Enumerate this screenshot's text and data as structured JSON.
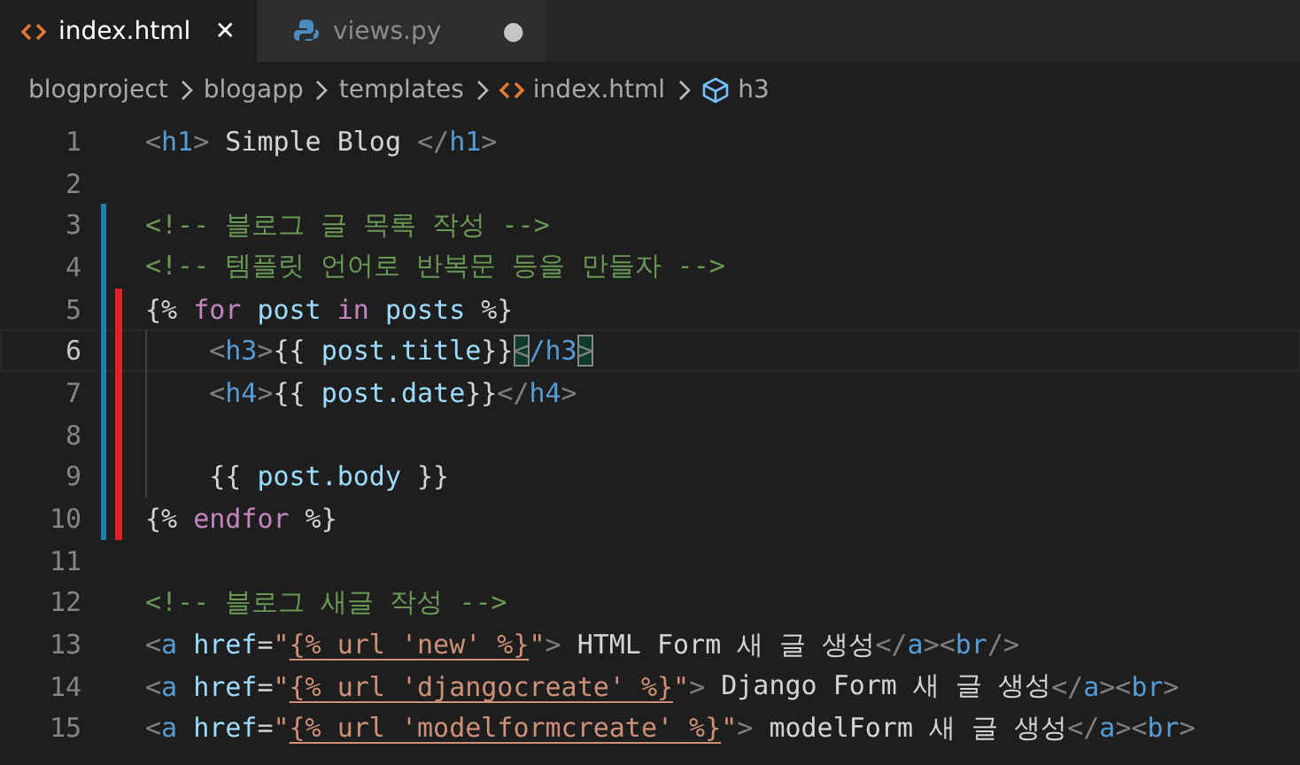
{
  "tabs": [
    {
      "label": "index.html",
      "kind": "html",
      "selected": true,
      "dirty": false,
      "close": "✕"
    },
    {
      "label": "views.py",
      "kind": "python",
      "selected": false,
      "dirty": true,
      "close": "●"
    }
  ],
  "breadcrumb": [
    {
      "label": "blogproject",
      "kind": "folder"
    },
    {
      "label": "blogapp",
      "kind": "folder"
    },
    {
      "label": "templates",
      "kind": "folder"
    },
    {
      "label": "index.html",
      "kind": "html"
    },
    {
      "label": "h3",
      "kind": "element"
    }
  ],
  "lines": [
    {
      "number": "1",
      "current": false,
      "modified": false,
      "annotated": false,
      "indented": false,
      "tokens": [
        {
          "kind": "punct",
          "text": "<"
        },
        {
          "kind": "tag",
          "text": "h1"
        },
        {
          "kind": "punct",
          "text": ">"
        },
        {
          "kind": "text",
          "text": " Simple Blog "
        },
        {
          "kind": "punct",
          "text": "</"
        },
        {
          "kind": "tag",
          "text": "h1"
        },
        {
          "kind": "punct",
          "text": ">"
        }
      ]
    },
    {
      "number": "2",
      "current": false,
      "modified": false,
      "annotated": false,
      "indented": false
    },
    {
      "number": "3",
      "current": false,
      "modified": true,
      "annotated": false,
      "indented": false,
      "tokens": [
        {
          "kind": "comment",
          "text": "<!-- 블로그 글 목록 작성 -->"
        }
      ]
    },
    {
      "number": "4",
      "current": false,
      "modified": true,
      "annotated": false,
      "indented": false,
      "tokens": [
        {
          "kind": "comment",
          "text": "<!-- 템플릿 언어로 반복문 등을 만들자 -->"
        }
      ]
    },
    {
      "number": "5",
      "current": false,
      "modified": true,
      "annotated": true,
      "indented": false,
      "tokens": [
        {
          "kind": "brace",
          "text": "{% "
        },
        {
          "kind": "keyword",
          "text": "for"
        },
        {
          "kind": "var",
          "text": " post "
        },
        {
          "kind": "keyword",
          "text": "in"
        },
        {
          "kind": "var",
          "text": " posts "
        },
        {
          "kind": "brace",
          "text": "%}"
        }
      ]
    },
    {
      "number": "6",
      "current": true,
      "modified": true,
      "annotated": true,
      "indented": true,
      "tokens": [
        {
          "kind": "punct",
          "text": "<"
        },
        {
          "kind": "tag",
          "text": "h3"
        },
        {
          "kind": "punct",
          "text": ">"
        },
        {
          "kind": "brace",
          "text": "{{ "
        },
        {
          "kind": "var",
          "text": "post.title"
        },
        {
          "kind": "brace",
          "text": "}}"
        },
        {
          "kind": "match",
          "text": "<"
        },
        {
          "kind": "tag",
          "text": "/h3"
        },
        {
          "kind": "match",
          "text": ">"
        }
      ]
    },
    {
      "number": "7",
      "current": false,
      "modified": true,
      "annotated": true,
      "indented": true,
      "tokens": [
        {
          "kind": "punct",
          "text": "<"
        },
        {
          "kind": "tag",
          "text": "h4"
        },
        {
          "kind": "punct",
          "text": ">"
        },
        {
          "kind": "brace",
          "text": "{{ "
        },
        {
          "kind": "var",
          "text": "post.date"
        },
        {
          "kind": "brace",
          "text": "}}"
        },
        {
          "kind": "punct",
          "text": "</"
        },
        {
          "kind": "tag",
          "text": "h4"
        },
        {
          "kind": "punct",
          "text": ">"
        }
      ]
    },
    {
      "number": "8",
      "current": false,
      "modified": true,
      "annotated": true,
      "indented": true
    },
    {
      "number": "9",
      "current": false,
      "modified": true,
      "annotated": true,
      "indented": true,
      "tokens": [
        {
          "kind": "brace",
          "text": "{{ "
        },
        {
          "kind": "var",
          "text": "post.body"
        },
        {
          "kind": "brace",
          "text": " }}"
        }
      ]
    },
    {
      "number": "10",
      "current": false,
      "modified": true,
      "annotated": true,
      "indented": false,
      "tokens": [
        {
          "kind": "brace",
          "text": "{% "
        },
        {
          "kind": "keyword",
          "text": "endfor"
        },
        {
          "kind": "brace",
          "text": " %}"
        }
      ]
    },
    {
      "number": "11",
      "current": false,
      "modified": false,
      "annotated": false,
      "indented": false
    },
    {
      "number": "12",
      "current": false,
      "modified": false,
      "annotated": false,
      "indented": false,
      "tokens": [
        {
          "kind": "comment",
          "text": "<!-- 블로그 새글 작성 -->"
        }
      ]
    },
    {
      "number": "13",
      "current": false,
      "modified": false,
      "annotated": false,
      "indented": false,
      "tokens": [
        {
          "kind": "punct",
          "text": "<"
        },
        {
          "kind": "tag",
          "text": "a"
        },
        {
          "kind": "attr",
          "text": " href"
        },
        {
          "kind": "text",
          "text": "="
        },
        {
          "kind": "string",
          "text": "\""
        },
        {
          "kind": "template",
          "text": "{% url 'new' %}"
        },
        {
          "kind": "string",
          "text": "\""
        },
        {
          "kind": "punct",
          "text": ">"
        },
        {
          "kind": "text",
          "text": " HTML Form 새 글 생성"
        },
        {
          "kind": "punct",
          "text": "</"
        },
        {
          "kind": "tag",
          "text": "a"
        },
        {
          "kind": "punct",
          "text": "><"
        },
        {
          "kind": "tag",
          "text": "br"
        },
        {
          "kind": "punct",
          "text": "/>"
        }
      ]
    },
    {
      "number": "14",
      "current": false,
      "modified": false,
      "annotated": false,
      "indented": false,
      "tokens": [
        {
          "kind": "punct",
          "text": "<"
        },
        {
          "kind": "tag",
          "text": "a"
        },
        {
          "kind": "attr",
          "text": " href"
        },
        {
          "kind": "text",
          "text": "="
        },
        {
          "kind": "string",
          "text": "\""
        },
        {
          "kind": "template",
          "text": "{% url 'djangocreate' %}"
        },
        {
          "kind": "string",
          "text": "\""
        },
        {
          "kind": "punct",
          "text": ">"
        },
        {
          "kind": "text",
          "text": " Django Form 새 글 생성"
        },
        {
          "kind": "punct",
          "text": "</"
        },
        {
          "kind": "tag",
          "text": "a"
        },
        {
          "kind": "punct",
          "text": "><"
        },
        {
          "kind": "tag",
          "text": "br"
        },
        {
          "kind": "punct",
          "text": ">"
        }
      ]
    },
    {
      "number": "15",
      "current": false,
      "modified": false,
      "annotated": false,
      "indented": false,
      "tokens": [
        {
          "kind": "punct",
          "text": "<"
        },
        {
          "kind": "tag",
          "text": "a"
        },
        {
          "kind": "attr",
          "text": " href"
        },
        {
          "kind": "text",
          "text": "="
        },
        {
          "kind": "string",
          "text": "\""
        },
        {
          "kind": "template",
          "text": "{% url 'modelformcreate' %}"
        },
        {
          "kind": "string",
          "text": "\""
        },
        {
          "kind": "punct",
          "text": ">"
        },
        {
          "kind": "text",
          "text": " modelForm 새 글 생성"
        },
        {
          "kind": "punct",
          "text": "</"
        },
        {
          "kind": "tag",
          "text": "a"
        },
        {
          "kind": "punct",
          "text": "><"
        },
        {
          "kind": "tag",
          "text": "br"
        },
        {
          "kind": "punct",
          "text": ">"
        }
      ]
    }
  ]
}
